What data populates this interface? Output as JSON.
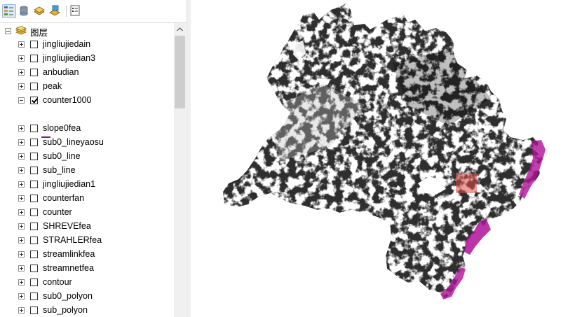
{
  "toc": {
    "toolbar": {
      "buttons": [
        {
          "name": "list-by-drawing-order-button",
          "icon": "drawing-order-icon",
          "active": true
        },
        {
          "name": "list-by-source-button",
          "icon": "database-icon",
          "active": false
        },
        {
          "name": "list-by-visibility-button",
          "icon": "layers-icon",
          "active": false
        },
        {
          "name": "list-by-selection-button",
          "icon": "selection-icon",
          "active": false
        },
        {
          "name": "options-button",
          "icon": "options-icon",
          "active": false
        }
      ]
    },
    "root_label": "图层",
    "layers": [
      {
        "label": "jingliujiedain",
        "checked": false,
        "expanded": false
      },
      {
        "label": "jingliujiedian3",
        "checked": false,
        "expanded": false
      },
      {
        "label": "anbudian",
        "checked": false,
        "expanded": false
      },
      {
        "label": "peak",
        "checked": false,
        "expanded": false
      },
      {
        "label": "counter1000",
        "checked": true,
        "expanded": true
      },
      {
        "label": "slope0fea",
        "checked": false,
        "expanded": false
      },
      {
        "label": "sub0_lineyaosu",
        "checked": false,
        "expanded": false
      },
      {
        "label": "sub0_line",
        "checked": false,
        "expanded": false
      },
      {
        "label": "sub_line",
        "checked": false,
        "expanded": false
      },
      {
        "label": "jingliujiedian1",
        "checked": false,
        "expanded": false
      },
      {
        "label": "counterfan",
        "checked": false,
        "expanded": false
      },
      {
        "label": "counter",
        "checked": false,
        "expanded": false
      },
      {
        "label": "SHREVEfea",
        "checked": false,
        "expanded": false
      },
      {
        "label": "STRAHLERfea",
        "checked": false,
        "expanded": false
      },
      {
        "label": "streamlinkfea",
        "checked": false,
        "expanded": false
      },
      {
        "label": "streamnetfea",
        "checked": false,
        "expanded": false
      },
      {
        "label": "contour",
        "checked": false,
        "expanded": false
      },
      {
        "label": "sub0_polyon",
        "checked": false,
        "expanded": false
      },
      {
        "label": "sub_polyon",
        "checked": false,
        "expanded": false
      }
    ],
    "legend_color": "#8a1a7a"
  },
  "map": {
    "terrain_color": "#2e2e2e",
    "highlight_color": "#e0504a",
    "stream_color": "#b0109a"
  }
}
